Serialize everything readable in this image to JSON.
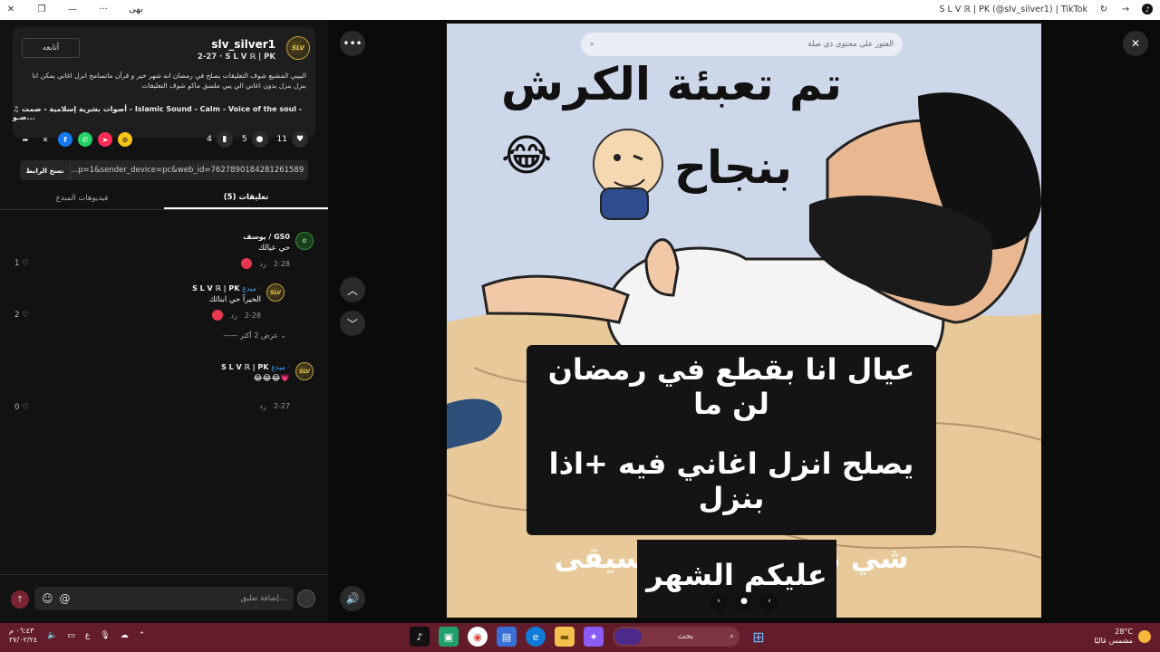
{
  "window": {
    "title": "S L V ℝ | PK (@slv_silver1) | TikTok",
    "left_label": "بھی"
  },
  "video": {
    "search_placeholder": "العثور على محتوى ذي صلة",
    "headline_line1": "تم تعبئة الكرش",
    "headline_line2": "بنجاح",
    "emoji": "😂",
    "caption_lines": [
      "عيال انا بقطع في رمضان لن ما",
      "يصلح انزل اغاني فيه +اذا بنزل",
      "شي بنزله بدون موسيقى مبارك",
      "عليكم الشهر"
    ],
    "more_icon": "more-icon",
    "volume_icon": "volume-icon",
    "close_icon": "close-icon"
  },
  "post": {
    "username": "slv_silver1",
    "subline": "2-27 · S L V ℝ | PK",
    "follow_label": "أتابعه",
    "avatar_text": "SLV",
    "description": "البيبي المشبع شوف التعليقات يصلح في رمضان انه شهر خير و قرآن ماتسامح انزل اغاني يمكن انا بنزل بنزل بدون اغاني الي يبي ملسق ماكو شوف التعليقات",
    "music": "أصوات بشرية إسلامية - صمت - Islamic Sound - Calm - Voice of the soul - صـو...",
    "likes": "11",
    "comments": "5",
    "saves": "4",
    "link_copy_label": "نسخ الرابط",
    "link_url": "...p=1&sender_device=pc&web_id=7627890184281261589"
  },
  "tabs": {
    "comments": "تعليقات (5)",
    "creator_videos": "فيديوهات المبدع"
  },
  "comments": [
    {
      "name": "يوسف / GS0",
      "creator": "",
      "text": "حي عيالك",
      "date": "2-28",
      "reply": "رد",
      "likes": "1"
    },
    {
      "name": "S L V ℝ | PK",
      "creator": "مبدع ·",
      "text": "الخيرآ حي ابنائك",
      "date": "2-28",
      "reply": "رد",
      "likes": "2"
    },
    {
      "name": "S L V ℝ | PK",
      "creator": "مبدع ·",
      "text": "😂😂😂💗",
      "date": "2-27",
      "reply": "رد",
      "likes": "0"
    }
  ],
  "view_more": "عرض 2 أكثر",
  "composer": {
    "placeholder": "إضافة تعليق..."
  },
  "taskbar": {
    "clock_time": "٠٦:٤٣ م",
    "clock_date": "٢٧/٠٢/٢٤",
    "lang": "ع",
    "search_label": "بحث",
    "temp": "28°C",
    "weather_text": "مشمس غالبًا"
  }
}
